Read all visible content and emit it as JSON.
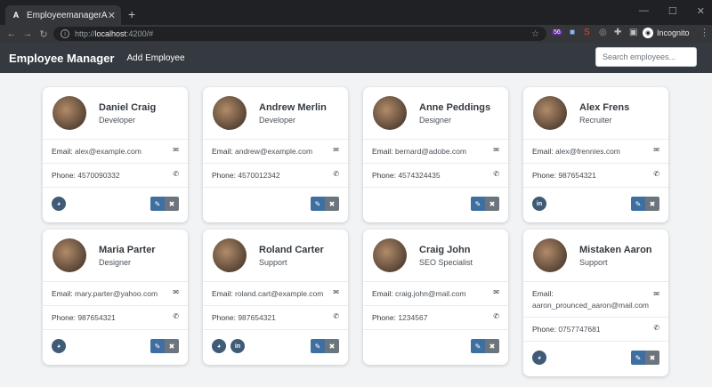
{
  "browser": {
    "tab_title": "EmployeemanagerAngular",
    "tab_icon_glyph": "A",
    "url_prefix": "http://",
    "url_host": "localhost",
    "url_rest": ":4200/#",
    "incognito_label": "Incognito"
  },
  "app": {
    "brand": "Employee Manager",
    "add_link": "Add Employee",
    "search_placeholder": "Search employees..."
  },
  "labels": {
    "email": "Email:",
    "phone": "Phone:"
  },
  "employees": [
    {
      "name": "Daniel Craig",
      "job": "Developer",
      "email": "alex@example.com",
      "phone": "4570090332",
      "socials": [
        "globe"
      ]
    },
    {
      "name": "Andrew Merlin",
      "job": "Developer",
      "email": "andrew@example.com",
      "phone": "4570012342",
      "socials": []
    },
    {
      "name": "Anne Peddings",
      "job": "Designer",
      "email": "bernard@adobe.com",
      "phone": "4574324435",
      "socials": []
    },
    {
      "name": "Alex Frens",
      "job": "Recruiter",
      "email": "alex@frennies.com",
      "phone": "987654321",
      "socials": [
        "linkedin"
      ]
    },
    {
      "name": "Maria Parter",
      "job": "Designer",
      "email": "mary.parter@yahoo.com",
      "phone": "987654321",
      "socials": [
        "globe"
      ]
    },
    {
      "name": "Roland Carter",
      "job": "Support",
      "email": "roland.cart@example.com",
      "phone": "987654321",
      "socials": [
        "globe",
        "linkedin"
      ]
    },
    {
      "name": "Craig John",
      "job": "SEO Specialist",
      "email": "craig.john@mail.com",
      "phone": "1234567",
      "socials": []
    },
    {
      "name": "Mistaken Aaron",
      "job": "Support",
      "email": "aaron_prounced_aaron@mail.com",
      "phone": "0757747681",
      "socials": [
        "globe"
      ]
    }
  ],
  "social_glyphs": {
    "globe": "◕",
    "linkedin": "in"
  },
  "icons": {
    "email": "✉",
    "phone": "✆",
    "edit": "✎",
    "delete": "✖"
  }
}
